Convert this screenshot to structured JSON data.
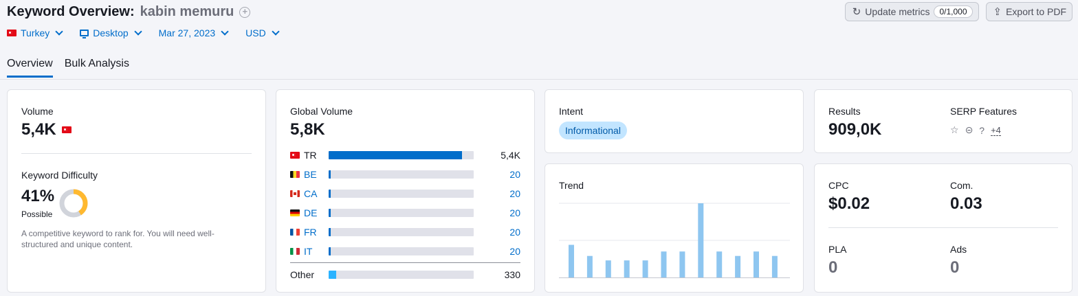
{
  "header": {
    "title": "Keyword Overview:",
    "keyword": "kabin memuru"
  },
  "filters": {
    "country": "Turkey",
    "device": "Desktop",
    "date": "Mar 27, 2023",
    "currency": "USD"
  },
  "actions": {
    "update_label": "Update metrics",
    "update_counter": "0/1,000",
    "export_label": "Export to PDF"
  },
  "tabs": [
    {
      "label": "Overview",
      "active": true
    },
    {
      "label": "Bulk Analysis",
      "active": false
    }
  ],
  "volume": {
    "label": "Volume",
    "value": "5,4K"
  },
  "difficulty": {
    "label": "Keyword Difficulty",
    "value": "41%",
    "percent": 41,
    "level": "Possible",
    "description": "A competitive keyword to rank for. You will need well-structured and unique content.",
    "color": "#ffb930"
  },
  "global_volume": {
    "label": "Global Volume",
    "value": "5,8K",
    "rows": [
      {
        "code": "TR",
        "value": "5,4K",
        "fraction": 0.92,
        "flag": "flag-tr",
        "link": false
      },
      {
        "code": "BE",
        "value": "20",
        "fraction": 0.012,
        "flag": "flag-be",
        "link": true
      },
      {
        "code": "CA",
        "value": "20",
        "fraction": 0.012,
        "flag": "flag-ca",
        "link": true
      },
      {
        "code": "DE",
        "value": "20",
        "fraction": 0.012,
        "flag": "flag-de",
        "link": true
      },
      {
        "code": "FR",
        "value": "20",
        "fraction": 0.012,
        "flag": "flag-fr",
        "link": true
      },
      {
        "code": "IT",
        "value": "20",
        "fraction": 0.012,
        "flag": "flag-it",
        "link": true
      }
    ],
    "other": {
      "label": "Other",
      "value": "330",
      "fraction": 0.05
    }
  },
  "intent": {
    "label": "Intent",
    "value": "Informational"
  },
  "results": {
    "label": "Results",
    "value": "909,0K"
  },
  "serp_features": {
    "label": "SERP Features",
    "icons": [
      "star-icon",
      "link-icon",
      "question-icon"
    ],
    "more": "+4"
  },
  "trend": {
    "label": "Trend",
    "bar_color": "#8ec6f0",
    "values": [
      0.44,
      0.29,
      0.23,
      0.23,
      0.23,
      0.35,
      0.35,
      1.0,
      0.35,
      0.29,
      0.35,
      0.29
    ]
  },
  "cpc": {
    "label": "CPC",
    "value": "$0.02"
  },
  "competition": {
    "label": "Com.",
    "value": "0.03"
  },
  "pla": {
    "label": "PLA",
    "value": "0"
  },
  "ads": {
    "label": "Ads",
    "value": "0"
  }
}
